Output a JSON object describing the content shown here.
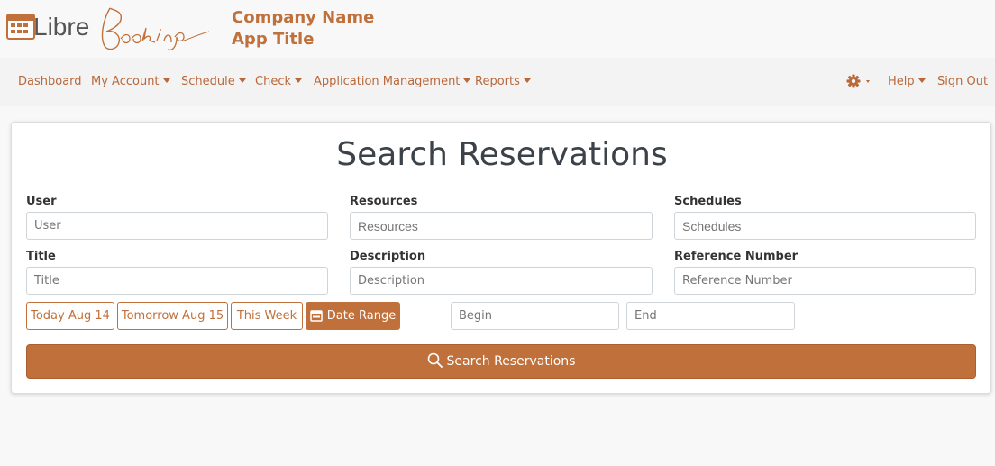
{
  "header": {
    "logo_text": "LibreBooking",
    "company_name": "Company Name",
    "app_title": "App Title"
  },
  "nav": {
    "items": [
      {
        "label": "Dashboard",
        "dropdown": false
      },
      {
        "label": "My Account",
        "dropdown": true
      },
      {
        "label": "Schedule",
        "dropdown": true
      },
      {
        "label": "Check",
        "dropdown": true
      },
      {
        "label": "Application Management",
        "dropdown": true
      },
      {
        "label": "Reports",
        "dropdown": true
      }
    ],
    "right": {
      "settings_icon": "gear-icon",
      "help": "Help",
      "sign_out": "Sign Out"
    }
  },
  "main": {
    "title": "Search Reservations",
    "fields": {
      "user": {
        "label": "User",
        "placeholder": "User"
      },
      "resources": {
        "label": "Resources",
        "placeholder": "Resources"
      },
      "schedules": {
        "label": "Schedules",
        "placeholder": "Schedules"
      },
      "title": {
        "label": "Title",
        "placeholder": "Title"
      },
      "description": {
        "label": "Description",
        "placeholder": "Description"
      },
      "reference": {
        "label": "Reference Number",
        "placeholder": "Reference Number"
      }
    },
    "date_buttons": {
      "today": "Today Aug 14",
      "tomorrow": "Tomorrow Aug 15",
      "this_week": "This Week",
      "date_range": "Date Range"
    },
    "begin_placeholder": "Begin",
    "end_placeholder": "End",
    "search_button": "Search Reservations"
  },
  "colors": {
    "accent": "#c0703a",
    "nav_link": "#b9683a",
    "title_text": "#3c4249"
  }
}
